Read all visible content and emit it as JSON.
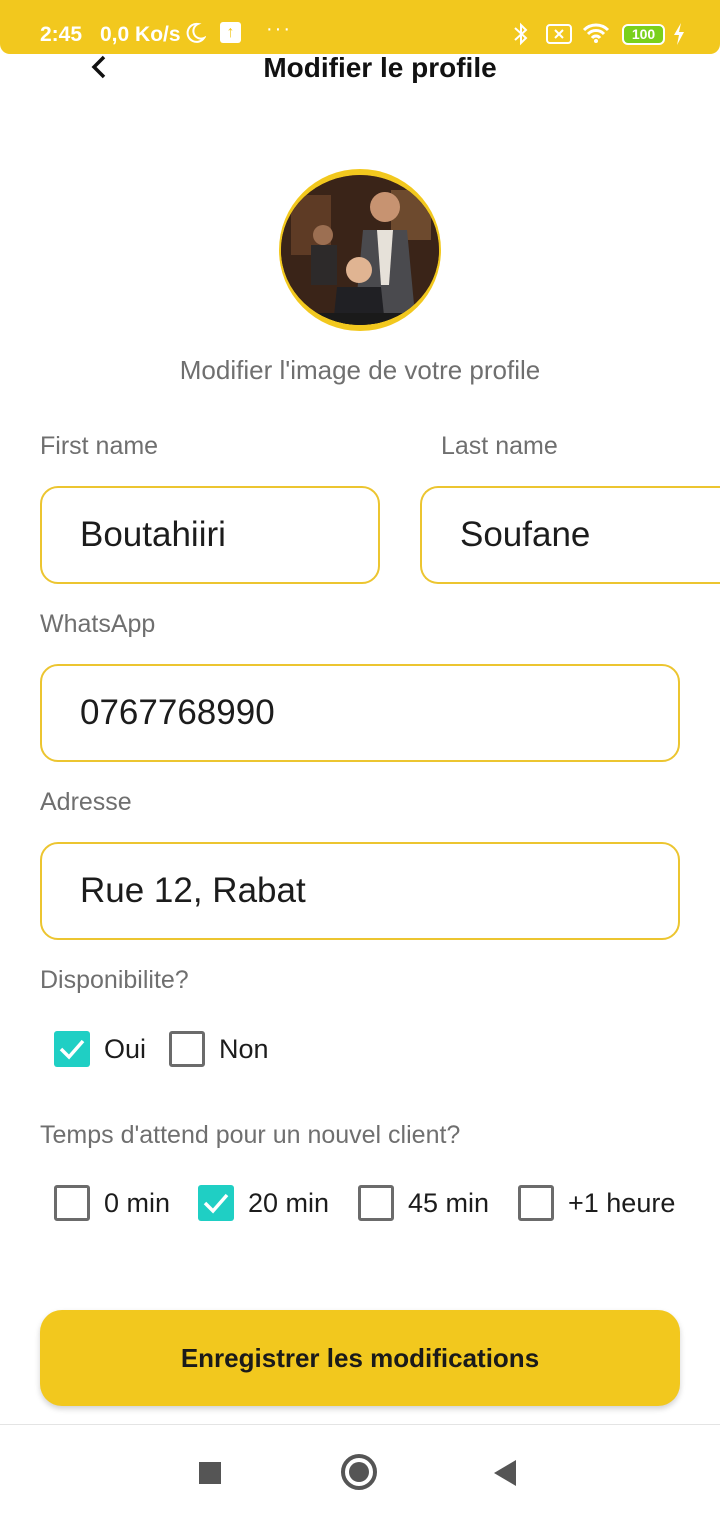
{
  "status_bar": {
    "time": "2:45",
    "network_speed": "0,0 Ko/s",
    "dots": "···",
    "battery": "100"
  },
  "header": {
    "title": "Modifier le profile"
  },
  "profile": {
    "change_photo_label": "Modifier l'image de votre profile"
  },
  "form": {
    "first_name": {
      "label": "First name",
      "value": "Boutahiiri"
    },
    "last_name": {
      "label": "Last name",
      "value": "Soufane"
    },
    "whatsapp": {
      "label": "WhatsApp",
      "value": "0767768990"
    },
    "address": {
      "label": "Adresse",
      "value": "Rue 12, Rabat"
    },
    "availability": {
      "label": "Disponibilite?",
      "options": [
        {
          "label": "Oui",
          "checked": true
        },
        {
          "label": "Non",
          "checked": false
        }
      ]
    },
    "wait_time": {
      "label": "Temps d'attend pour un nouvel client?",
      "options": [
        {
          "label": "0 min",
          "checked": false
        },
        {
          "label": "20 min",
          "checked": true
        },
        {
          "label": "45 min",
          "checked": false
        },
        {
          "label": "+1 heure",
          "checked": false
        }
      ]
    },
    "save_label": "Enregistrer les modifications"
  },
  "colors": {
    "accent": "#f2c81e",
    "checkbox_checked": "#1fcfc4",
    "input_border": "#ecc530"
  },
  "icons": {
    "back": "chevron-left-icon",
    "checkmark": "check-icon",
    "nav_recents": "square-icon",
    "nav_home": "circle-icon",
    "nav_back": "triangle-back-icon"
  }
}
